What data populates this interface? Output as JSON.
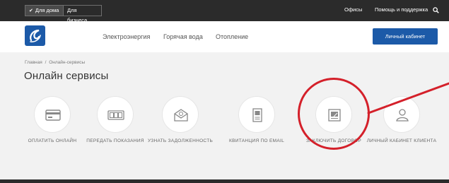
{
  "topbar": {
    "home_label": "Для дома",
    "business_label": "Для бизнеса",
    "offices_label": "Офисы",
    "help_label": "Помощь и поддержка"
  },
  "header": {
    "nav": [
      "Электроэнергия",
      "Горячая вода",
      "Отопление"
    ],
    "cabinet_label": "Личный кабинет"
  },
  "breadcrumb": {
    "home": "Главная",
    "separator": "/",
    "current": "Онлайн-сервисы"
  },
  "page_title": "Онлайн сервисы",
  "services": [
    {
      "label": "оплатить онлайн",
      "icon": "card-icon"
    },
    {
      "label": "передать показания",
      "icon": "meter-icon"
    },
    {
      "label": "узнать задолженность",
      "icon": "envelope-icon"
    },
    {
      "label": "квитанция по email",
      "icon": "receipt-icon"
    },
    {
      "label": "заключить договор",
      "icon": "contract-icon"
    },
    {
      "label": "личный кабинет клиента",
      "icon": "user-icon"
    }
  ],
  "colors": {
    "topbar": "#2b2b2b",
    "brand": "#1c5aa8",
    "annotation": "#d4202a",
    "background": "#f2f2f2"
  }
}
